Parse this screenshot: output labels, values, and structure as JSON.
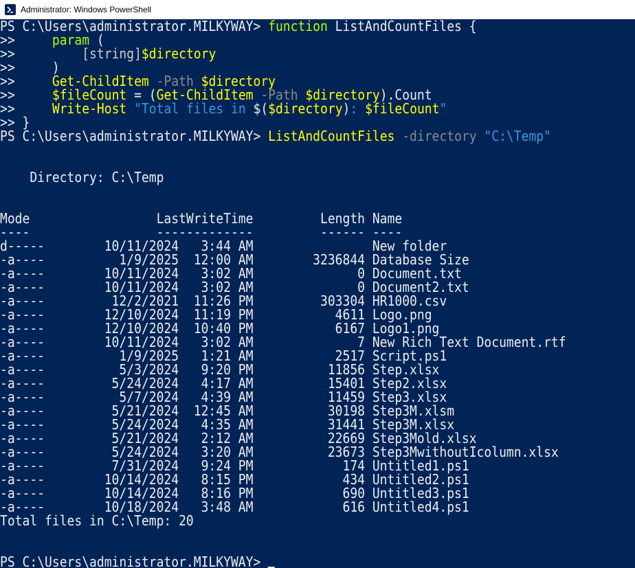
{
  "window": {
    "title": "Administrator: Windows PowerShell",
    "icon": "powershell-icon"
  },
  "colors": {
    "background": "#012456",
    "text": "#eeedf0",
    "keyword": "#b4ff00",
    "variable": "#ffff00",
    "parameter": "#8a8a8a",
    "string": "#3a96dd",
    "command": "#f9f1a5"
  },
  "console": {
    "prompt": "PS C:\\Users\\administrator.MILKYWAY> ",
    "cont": ">>",
    "func_line": {
      "keyword": "function",
      "name": " ListAndCountFiles {"
    },
    "param_line": {
      "indent": "     ",
      "keyword": "param",
      "rest": " ("
    },
    "string_type_line": {
      "indent": "         ",
      "type": "[string]",
      "var": "$directory"
    },
    "close_paren_line": {
      "indent": "     ",
      "text": ")"
    },
    "gci_line": {
      "indent": "     ",
      "cmd": "Get-ChildItem",
      "param": " -Path",
      "var": " $directory"
    },
    "count_line": {
      "indent": "     ",
      "var": "$fileCount",
      "op": " = (",
      "cmd": "Get-ChildItem",
      "param": " -Path",
      "var2": " $directory",
      "rest": ").Count"
    },
    "write_line": {
      "indent": "     ",
      "cmd": "Write-Host",
      "str1": " \"Total files in ",
      "sub_open": "$(",
      "var": "$directory",
      "sub_close": ")",
      "str2": ": ",
      "var2": "$fileCount",
      "str3": "\""
    },
    "close_brace": " }",
    "invoke_line": {
      "cmd": "ListAndCountFiles",
      "param": " -directory",
      "arg": " \"C:\\Temp\""
    },
    "directory_label": "    Directory: C:\\Temp",
    "header": "Mode                 LastWriteTime         Length Name",
    "underline": "----                 -------------         ------ ----",
    "rows": [
      "d-----        10/11/2024   3:44 AM                New folder",
      "-a----          1/9/2025  12:00 AM        3236844 Database Size",
      "-a----        10/11/2024   3:02 AM              0 Document.txt",
      "-a----        10/11/2024   3:02 AM              0 Document2.txt",
      "-a----         12/2/2021  11:26 PM         303304 HR1000.csv",
      "-a----        12/10/2024  11:19 PM           4611 Logo.png",
      "-a----        12/10/2024  10:40 PM           6167 Logo1.png",
      "-a----        10/11/2024   3:02 AM              7 New Rich Text Document.rtf",
      "-a----          1/9/2025   1:21 AM           2517 Script.ps1",
      "-a----          5/3/2024   9:20 PM          11856 Step.xlsx",
      "-a----         5/24/2024   4:17 AM          15401 Step2.xlsx",
      "-a----          5/7/2024   4:39 AM          11459 Step3.xlsx",
      "-a----         5/21/2024  12:45 AM          30198 Step3M.xlsm",
      "-a----         5/24/2024   4:35 AM          31441 Step3M.xlsx",
      "-a----         5/21/2024   2:12 AM          22669 Step3Mold.xlsx",
      "-a----         5/24/2024   3:20 AM          23673 Step3MwithoutIcolumn.xlsx",
      "-a----         7/31/2024   9:24 PM            174 Untitled1.ps1",
      "-a----        10/14/2024   8:15 PM            434 Untitled2.ps1",
      "-a----        10/14/2024   8:16 PM            690 Untitled3.ps1",
      "-a----        10/18/2024   3:48 AM            616 Untitled4.ps1"
    ],
    "total": "Total files in C:\\Temp: 20",
    "final_prompt": "PS C:\\Users\\administrator.MILKYWAY> "
  }
}
